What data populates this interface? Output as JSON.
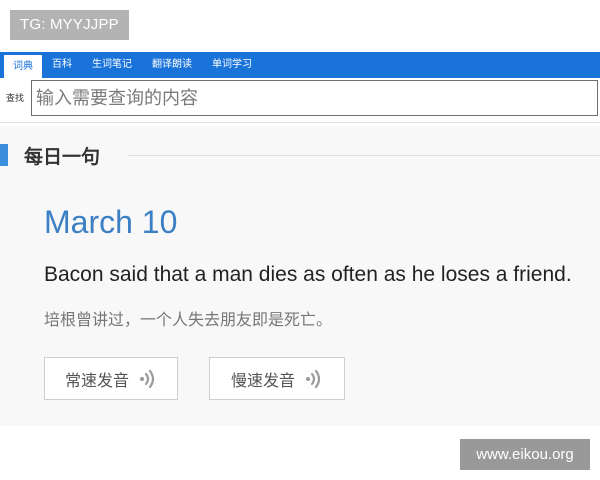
{
  "watermark": {
    "tg_text": "TG: MYYJJPP",
    "site_text": "www.eikou.org"
  },
  "tabs": [
    {
      "label": "词典",
      "active": true
    },
    {
      "label": "百科",
      "active": false
    },
    {
      "label": "生词笔记",
      "active": false
    },
    {
      "label": "翻译朗读",
      "active": false
    },
    {
      "label": "单词学习",
      "active": false
    }
  ],
  "search": {
    "label": "查找",
    "placeholder": "输入需要查询的内容"
  },
  "daily": {
    "section_title": "每日一句",
    "date": "March 10",
    "sentence_en": "Bacon said that a man dies as often as he loses a friend.",
    "sentence_zh": "培根曾讲过，一个人失去朋友即是死亡。",
    "buttons": {
      "normal_speed": "常速发音",
      "slow_speed": "慢速发音"
    }
  },
  "colors": {
    "tab_bar": "#1a73d9",
    "accent": "#3b8edb",
    "date_text": "#3b7fc4"
  },
  "icons": {
    "speaker": "speaker-waves-icon"
  }
}
